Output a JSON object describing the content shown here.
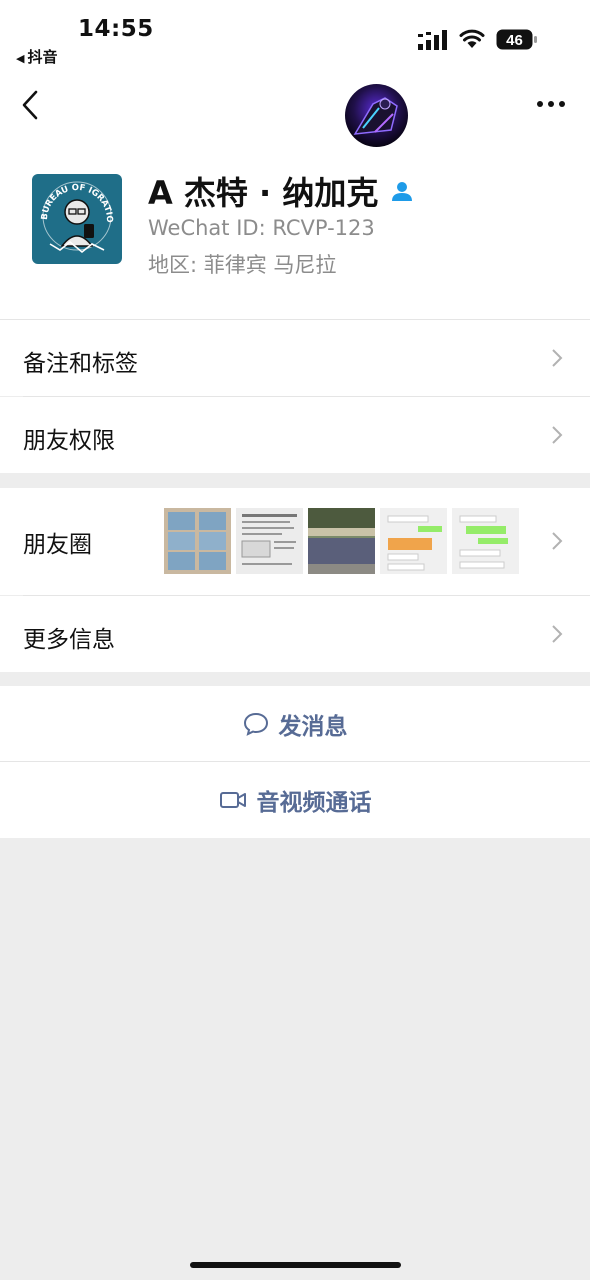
{
  "status_bar": {
    "time": "14:55",
    "back_app": "抖音",
    "battery": "46"
  },
  "profile": {
    "name": "A 杰特 · 纳加克",
    "wechat_id": "WeChat ID: RCVP-123",
    "region": "地区: 菲律宾 马尼拉",
    "avatar_caption": "BUREAU OF IGRATION"
  },
  "menu": {
    "remarks": "备注和标签",
    "permissions": "朋友权限",
    "moments": "朋友圈",
    "more_info": "更多信息"
  },
  "actions": {
    "message": "发消息",
    "video_call": "音视频通话"
  },
  "colors": {
    "link": "#576b95",
    "verify": "#1e9be8",
    "avatar_bg": "#1f6e88"
  }
}
